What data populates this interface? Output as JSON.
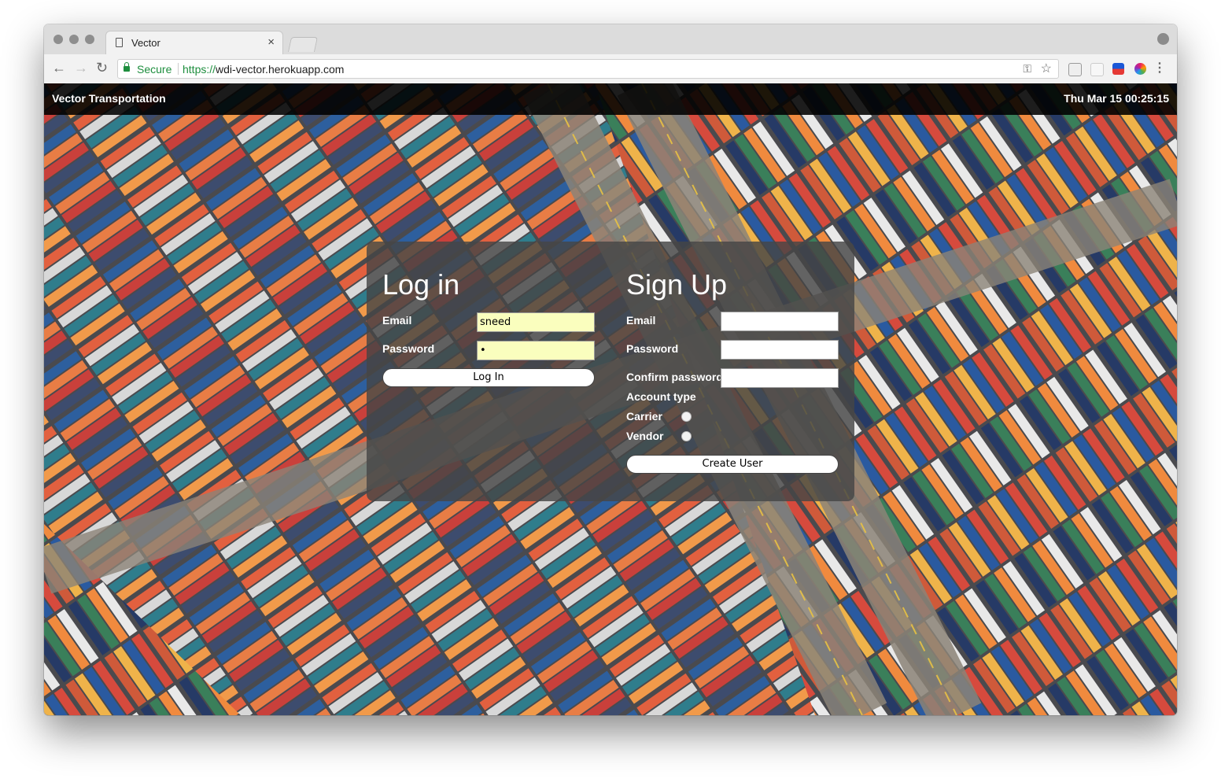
{
  "browser": {
    "tab_title": "Vector",
    "tab_close": "×",
    "secure_label": "Secure",
    "url_scheme": "https://",
    "url_host": "wdi-vector.herokuapp.com",
    "back_glyph": "←",
    "forward_glyph": "→",
    "reload_glyph": "↻",
    "key_glyph": "⚿",
    "star_glyph": "☆",
    "menu_glyph": "⋮",
    "secure_color": "#1e8e3e"
  },
  "navbar": {
    "brand": "Vector Transportation",
    "datetime": "Thu Mar 15 00:25:15"
  },
  "login": {
    "heading": "Log in",
    "email_label": "Email",
    "email_value": "sneed",
    "password_label": "Password",
    "password_value": "•",
    "submit_label": "Log In"
  },
  "signup": {
    "heading": "Sign Up",
    "email_label": "Email",
    "password_label": "Password",
    "confirm_label": "Confirm password",
    "account_type_label": "Account type",
    "carrier_label": "Carrier",
    "vendor_label": "Vendor",
    "submit_label": "Create User"
  }
}
